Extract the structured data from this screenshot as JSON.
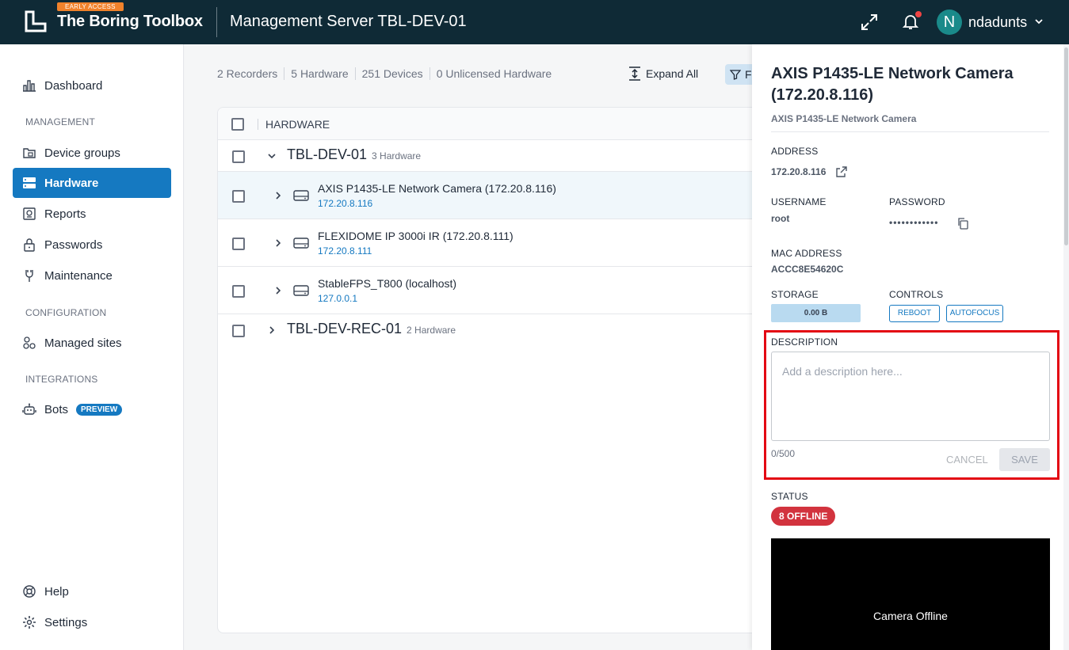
{
  "header": {
    "early_access": "EARLY ACCESS",
    "brand": "The Boring Toolbox",
    "server_title": "Management Server TBL-DEV-01",
    "user_initial": "N",
    "username": "ndadunts"
  },
  "sidebar": {
    "dashboard": "Dashboard",
    "section_management": "MANAGEMENT",
    "device_groups": "Device groups",
    "hardware": "Hardware",
    "reports": "Reports",
    "passwords": "Passwords",
    "maintenance": "Maintenance",
    "section_configuration": "CONFIGURATION",
    "managed_sites": "Managed sites",
    "section_integrations": "INTEGRATIONS",
    "bots": "Bots",
    "bots_badge": "PREVIEW",
    "help": "Help",
    "settings": "Settings"
  },
  "main": {
    "stats": [
      "2 Recorders",
      "5 Hardware",
      "251 Devices",
      "0 Unlicensed Hardware"
    ],
    "expand_all": "Expand All",
    "filter_label": "F",
    "table_header": "HARDWARE",
    "groups": [
      {
        "name": "TBL-DEV-01",
        "count": "3 Hardware"
      },
      {
        "name": "TBL-DEV-REC-01",
        "count": "2 Hardware"
      }
    ],
    "hardware": [
      {
        "name": "AXIS P1435-LE Network Camera (172.20.8.116)",
        "ip": "172.20.8.116"
      },
      {
        "name": "FLEXIDOME IP 3000i IR (172.20.8.111)",
        "ip": "172.20.8.111"
      },
      {
        "name": "StableFPS_T800 (localhost)",
        "ip": "127.0.0.1"
      }
    ]
  },
  "panel": {
    "title": "AXIS P1435-LE Network Camera (172.20.8.116)",
    "subtitle": "AXIS P1435-LE Network Camera",
    "address_label": "ADDRESS",
    "address": "172.20.8.116",
    "username_label": "USERNAME",
    "username": "root",
    "password_label": "PASSWORD",
    "password": "••••••••••••",
    "mac_label": "MAC ADDRESS",
    "mac": "ACCC8E54620C",
    "storage_label": "STORAGE",
    "storage": "0.00 B",
    "controls_label": "CONTROLS",
    "reboot": "REBOOT",
    "autofocus": "AUTOFOCUS",
    "description_label": "DESCRIPTION",
    "description_placeholder": "Add a description here...",
    "char_count": "0/500",
    "cancel": "CANCEL",
    "save": "SAVE",
    "status_label": "STATUS",
    "status_badge": "8 OFFLINE",
    "camera_offline": "Camera Offline"
  },
  "colors": {
    "header_bg": "#0f2a36",
    "accent": "#1579c1",
    "early_access": "#f0822b",
    "offline": "#d2333e",
    "highlight_box": "#e30613"
  },
  "icons": [
    "logo-icon",
    "expand-icon",
    "bell-icon",
    "chevron-down-icon",
    "dashboard-icon",
    "device-groups-icon",
    "hardware-icon",
    "reports-icon",
    "lock-icon",
    "maintenance-icon",
    "managed-sites-icon",
    "bot-icon",
    "help-icon",
    "gear-icon",
    "expand-all-icon",
    "filter-icon",
    "chevron-right-icon",
    "server-icon",
    "external-link-icon",
    "copy-icon"
  ]
}
